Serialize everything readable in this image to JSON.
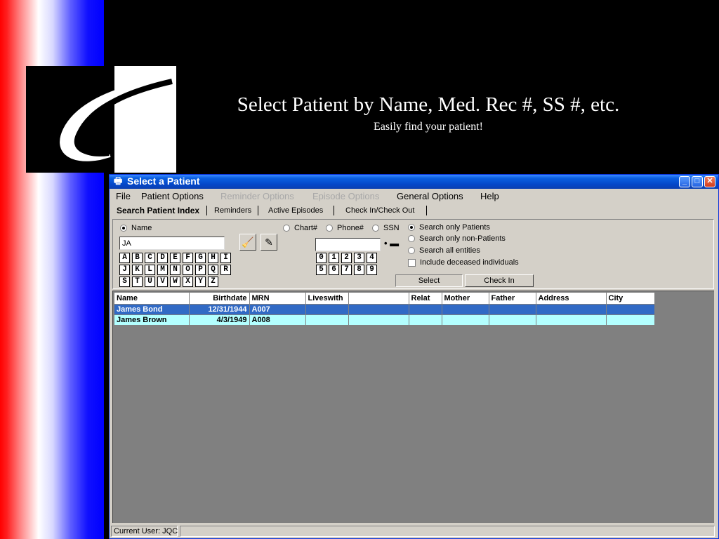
{
  "slide": {
    "title": "Select Patient by Name, Med. Rec #, SS #, etc.",
    "subtitle": "Easily find your patient!"
  },
  "window": {
    "title": "Select a Patient",
    "controls": {
      "minimize": "_",
      "maximize": "□",
      "close": "✕"
    }
  },
  "menu": {
    "file": "File",
    "patient_options": "Patient Options",
    "reminder_options": "Reminder Options",
    "episode_options": "Episode Options",
    "general_options": "General Options",
    "help": "Help"
  },
  "tabs": {
    "search_patient_index": "Search Patient Index",
    "reminders": "Reminders",
    "active_episodes": "Active Episodes",
    "check_in_out": "Check In/Check Out"
  },
  "search": {
    "name_label": "Name",
    "name_value": "JA",
    "chart_label": "Chart#",
    "phone_label": "Phone#",
    "ssn_label": "SSN",
    "number_value": "",
    "letters": [
      "A",
      "B",
      "C",
      "D",
      "E",
      "F",
      "G",
      "H",
      "I",
      "J",
      "K",
      "L",
      "M",
      "N",
      "O",
      "P",
      "Q",
      "R",
      "S",
      "T",
      "U",
      "V",
      "W",
      "X",
      "Y",
      "Z"
    ],
    "digits": [
      "0",
      "1",
      "2",
      "3",
      "4",
      "5",
      "6",
      "7",
      "8",
      "9"
    ],
    "scope_options": [
      "Search only Patients",
      "Search only non-Patients",
      "Search all entities"
    ],
    "selected_scope": "Search only Patients",
    "include_deceased_label": "Include deceased individuals",
    "select_button": "Select",
    "check_in_button": "Check In"
  },
  "grid": {
    "columns": [
      "Name",
      "Birthdate",
      "MRN",
      "Liveswith",
      "",
      "Relat",
      "Mother",
      "Father",
      "Address",
      "City"
    ],
    "rows": [
      {
        "name": "James Bond",
        "birthdate": "12/31/1944",
        "mrn": "A007",
        "selected": true
      },
      {
        "name": "James Brown",
        "birthdate": "4/3/1949",
        "mrn": "A008",
        "selected": false
      }
    ]
  },
  "status": {
    "current_user": "Current User: JQC"
  }
}
